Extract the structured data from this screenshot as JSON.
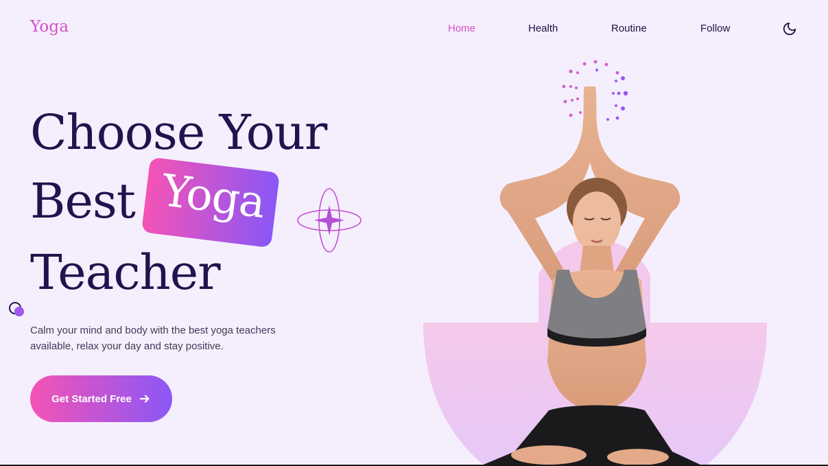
{
  "header": {
    "logo": "Yoga",
    "nav": [
      {
        "label": "Home",
        "active": true
      },
      {
        "label": "Health",
        "active": false
      },
      {
        "label": "Routine",
        "active": false
      },
      {
        "label": "Follow",
        "active": false
      }
    ],
    "theme_icon": "moon-icon"
  },
  "hero": {
    "title_line1": "Choose Your",
    "title_line2": "Best",
    "title_highlight": "Yoga",
    "title_line3": "Teacher",
    "description_line1": "Calm your mind and body with the best yoga teachers",
    "description_line2": "available, relax your day and stay positive.",
    "cta_label": "Get Started Free",
    "cta_icon": "arrow-right-icon"
  },
  "colors": {
    "background": "#f5effd",
    "accent_pink": "#f553b5",
    "accent_purple": "#8a57f6",
    "heading": "#23124d",
    "nav_active": "#d84ec5"
  }
}
